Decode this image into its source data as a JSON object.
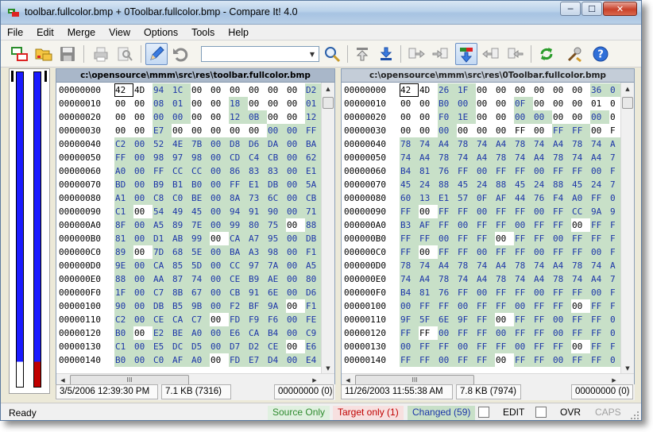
{
  "window": {
    "title": "toolbar.fullcolor.bmp + 0Toolbar.fullcolor.bmp - Compare It! 4.0",
    "min_glyph": "─",
    "max_glyph": "☐",
    "close_glyph": "✕"
  },
  "menu": [
    "File",
    "Edit",
    "Merge",
    "View",
    "Options",
    "Tools",
    "Help"
  ],
  "toolbar": {
    "search_value": "",
    "combo_arrow": "▼"
  },
  "colors": {
    "diff_bg": "#c8e0c8",
    "diff_text": "#1c36a8",
    "map_blue": "#1a1aff",
    "map_red": "#c00000",
    "source_only": "#2e8b2e",
    "target_only": "#c00000",
    "changed": "#1c36a8"
  },
  "left_pane": {
    "path": "c:\\opensource\\mmm\\src\\res\\toolbar.fullcolor.bmp",
    "date": "3/5/2006  12:39:30 PM",
    "size": "7.1 KB (7316)",
    "offset": "00000000 (0)",
    "scroll_glyph": "III",
    "rows": [
      {
        "addr": "00000000",
        "bytes": [
          "42",
          "4D",
          "94",
          "1C",
          "00",
          "00",
          "00",
          "00",
          "00",
          "00",
          "D2"
        ],
        "diff": [
          0,
          0,
          1,
          1,
          0,
          0,
          0,
          0,
          0,
          0,
          1
        ]
      },
      {
        "addr": "00000010",
        "bytes": [
          "00",
          "00",
          "08",
          "01",
          "00",
          "00",
          "18",
          "00",
          "00",
          "00",
          "01"
        ],
        "diff": [
          0,
          0,
          1,
          1,
          0,
          0,
          1,
          0,
          0,
          0,
          1
        ]
      },
      {
        "addr": "00000020",
        "bytes": [
          "00",
          "00",
          "00",
          "00",
          "00",
          "00",
          "12",
          "0B",
          "00",
          "00",
          "12"
        ],
        "diff": [
          0,
          0,
          1,
          1,
          0,
          0,
          1,
          1,
          0,
          0,
          1
        ]
      },
      {
        "addr": "00000030",
        "bytes": [
          "00",
          "00",
          "E7",
          "00",
          "00",
          "00",
          "00",
          "00",
          "00",
          "00",
          "FF"
        ],
        "diff": [
          0,
          0,
          1,
          0,
          0,
          0,
          0,
          0,
          1,
          1,
          1
        ]
      },
      {
        "addr": "00000040",
        "bytes": [
          "C2",
          "00",
          "52",
          "4E",
          "7B",
          "00",
          "D8",
          "D6",
          "DA",
          "00",
          "BA"
        ],
        "diff": [
          1,
          1,
          1,
          1,
          1,
          1,
          1,
          1,
          1,
          1,
          1
        ]
      },
      {
        "addr": "00000050",
        "bytes": [
          "FF",
          "00",
          "98",
          "97",
          "98",
          "00",
          "CD",
          "C4",
          "CB",
          "00",
          "62"
        ],
        "diff": [
          1,
          1,
          1,
          1,
          1,
          1,
          1,
          1,
          1,
          1,
          1
        ]
      },
      {
        "addr": "00000060",
        "bytes": [
          "A0",
          "00",
          "FF",
          "CC",
          "CC",
          "00",
          "86",
          "83",
          "83",
          "00",
          "E1"
        ],
        "diff": [
          1,
          1,
          1,
          1,
          1,
          1,
          1,
          1,
          1,
          1,
          1
        ]
      },
      {
        "addr": "00000070",
        "bytes": [
          "BD",
          "00",
          "B9",
          "B1",
          "B0",
          "00",
          "FF",
          "E1",
          "DB",
          "00",
          "5A"
        ],
        "diff": [
          1,
          1,
          1,
          1,
          1,
          1,
          1,
          1,
          1,
          1,
          1
        ]
      },
      {
        "addr": "00000080",
        "bytes": [
          "A1",
          "00",
          "C8",
          "C0",
          "BE",
          "00",
          "8A",
          "73",
          "6C",
          "00",
          "CB"
        ],
        "diff": [
          1,
          1,
          1,
          1,
          1,
          1,
          1,
          1,
          1,
          1,
          1
        ]
      },
      {
        "addr": "00000090",
        "bytes": [
          "C1",
          "00",
          "54",
          "49",
          "45",
          "00",
          "94",
          "91",
          "90",
          "00",
          "71"
        ],
        "diff": [
          1,
          0,
          1,
          1,
          1,
          1,
          1,
          1,
          1,
          1,
          1
        ]
      },
      {
        "addr": "000000A0",
        "bytes": [
          "8F",
          "00",
          "A5",
          "89",
          "7E",
          "00",
          "99",
          "80",
          "75",
          "00",
          "88"
        ],
        "diff": [
          1,
          1,
          1,
          1,
          1,
          1,
          1,
          1,
          1,
          0,
          1
        ]
      },
      {
        "addr": "000000B0",
        "bytes": [
          "81",
          "00",
          "D1",
          "AB",
          "99",
          "00",
          "CA",
          "A7",
          "95",
          "00",
          "DB"
        ],
        "diff": [
          1,
          1,
          1,
          1,
          1,
          0,
          1,
          1,
          1,
          1,
          1
        ]
      },
      {
        "addr": "000000C0",
        "bytes": [
          "89",
          "00",
          "7D",
          "68",
          "5E",
          "00",
          "BA",
          "A3",
          "98",
          "00",
          "F1"
        ],
        "diff": [
          1,
          0,
          1,
          1,
          1,
          1,
          1,
          1,
          1,
          1,
          1
        ]
      },
      {
        "addr": "000000D0",
        "bytes": [
          "9E",
          "00",
          "CA",
          "85",
          "5D",
          "00",
          "CC",
          "97",
          "7A",
          "00",
          "A5"
        ],
        "diff": [
          1,
          1,
          1,
          1,
          1,
          1,
          1,
          1,
          1,
          1,
          1
        ]
      },
      {
        "addr": "000000E0",
        "bytes": [
          "88",
          "00",
          "AA",
          "87",
          "74",
          "00",
          "CE",
          "B9",
          "AE",
          "00",
          "80"
        ],
        "diff": [
          1,
          1,
          1,
          1,
          1,
          1,
          1,
          1,
          1,
          1,
          1
        ]
      },
      {
        "addr": "000000F0",
        "bytes": [
          "1F",
          "00",
          "C7",
          "8B",
          "67",
          "00",
          "CB",
          "91",
          "6E",
          "00",
          "D6"
        ],
        "diff": [
          1,
          1,
          1,
          1,
          1,
          1,
          1,
          1,
          1,
          1,
          1
        ]
      },
      {
        "addr": "00000100",
        "bytes": [
          "90",
          "00",
          "DB",
          "B5",
          "9B",
          "00",
          "F2",
          "BF",
          "9A",
          "00",
          "F1"
        ],
        "diff": [
          1,
          1,
          1,
          1,
          1,
          1,
          1,
          1,
          1,
          0,
          1
        ]
      },
      {
        "addr": "00000110",
        "bytes": [
          "C2",
          "00",
          "CE",
          "CA",
          "C7",
          "00",
          "FD",
          "F9",
          "F6",
          "00",
          "FE"
        ],
        "diff": [
          1,
          1,
          1,
          1,
          1,
          0,
          1,
          1,
          1,
          1,
          1
        ]
      },
      {
        "addr": "00000120",
        "bytes": [
          "B0",
          "00",
          "E2",
          "BE",
          "A0",
          "00",
          "E6",
          "CA",
          "B4",
          "00",
          "C9"
        ],
        "diff": [
          1,
          0,
          1,
          1,
          1,
          1,
          1,
          1,
          1,
          1,
          1
        ]
      },
      {
        "addr": "00000130",
        "bytes": [
          "C1",
          "00",
          "E5",
          "DC",
          "D5",
          "00",
          "D7",
          "D2",
          "CE",
          "00",
          "E6"
        ],
        "diff": [
          1,
          1,
          1,
          1,
          1,
          1,
          1,
          1,
          1,
          0,
          1
        ]
      },
      {
        "addr": "00000140",
        "bytes": [
          "B0",
          "00",
          "C0",
          "AF",
          "A0",
          "00",
          "FD",
          "E7",
          "D4",
          "00",
          "E4"
        ],
        "diff": [
          1,
          1,
          1,
          1,
          1,
          0,
          1,
          1,
          1,
          1,
          1
        ]
      }
    ]
  },
  "right_pane": {
    "path": "c:\\opensource\\mmm\\src\\res\\0Toolbar.fullcolor.bmp",
    "date": "11/26/2003  11:55:38 AM",
    "size": "7.8 KB (7974)",
    "offset": "00000000 (0)",
    "scroll_glyph": "III",
    "rows": [
      {
        "addr": "00000000",
        "bytes": [
          "42",
          "4D",
          "26",
          "1F",
          "00",
          "00",
          "00",
          "00",
          "00",
          "00",
          "36",
          "0"
        ],
        "diff": [
          0,
          0,
          1,
          1,
          0,
          0,
          0,
          0,
          0,
          0,
          1,
          1
        ]
      },
      {
        "addr": "00000010",
        "bytes": [
          "00",
          "00",
          "B0",
          "00",
          "00",
          "00",
          "0F",
          "00",
          "00",
          "00",
          "01",
          "0"
        ],
        "diff": [
          0,
          0,
          1,
          1,
          0,
          0,
          1,
          0,
          0,
          0,
          0,
          0
        ]
      },
      {
        "addr": "00000020",
        "bytes": [
          "00",
          "00",
          "F0",
          "1E",
          "00",
          "00",
          "00",
          "00",
          "00",
          "00",
          "00",
          "0"
        ],
        "diff": [
          0,
          0,
          1,
          1,
          0,
          0,
          1,
          1,
          0,
          0,
          1,
          0
        ]
      },
      {
        "addr": "00000030",
        "bytes": [
          "00",
          "00",
          "00",
          "00",
          "00",
          "00",
          "FF",
          "00",
          "FF",
          "FF",
          "00",
          "F"
        ],
        "diff": [
          0,
          0,
          1,
          0,
          0,
          0,
          0,
          0,
          1,
          1,
          0,
          0
        ]
      },
      {
        "addr": "00000040",
        "bytes": [
          "78",
          "74",
          "A4",
          "78",
          "74",
          "A4",
          "78",
          "74",
          "A4",
          "78",
          "74",
          "A"
        ],
        "diff": [
          1,
          1,
          1,
          1,
          1,
          1,
          1,
          1,
          1,
          1,
          1,
          1
        ]
      },
      {
        "addr": "00000050",
        "bytes": [
          "74",
          "A4",
          "78",
          "74",
          "A4",
          "78",
          "74",
          "A4",
          "78",
          "74",
          "A4",
          "7"
        ],
        "diff": [
          1,
          1,
          1,
          1,
          1,
          1,
          1,
          1,
          1,
          1,
          1,
          1
        ]
      },
      {
        "addr": "00000060",
        "bytes": [
          "B4",
          "81",
          "76",
          "FF",
          "00",
          "FF",
          "FF",
          "00",
          "FF",
          "FF",
          "00",
          "F"
        ],
        "diff": [
          1,
          1,
          1,
          1,
          1,
          1,
          1,
          1,
          1,
          1,
          1,
          1
        ]
      },
      {
        "addr": "00000070",
        "bytes": [
          "45",
          "24",
          "88",
          "45",
          "24",
          "88",
          "45",
          "24",
          "88",
          "45",
          "24",
          "7"
        ],
        "diff": [
          1,
          1,
          1,
          1,
          1,
          1,
          1,
          1,
          1,
          1,
          1,
          1
        ]
      },
      {
        "addr": "00000080",
        "bytes": [
          "60",
          "13",
          "E1",
          "57",
          "0F",
          "AF",
          "44",
          "76",
          "F4",
          "A0",
          "FF",
          "0"
        ],
        "diff": [
          1,
          1,
          1,
          1,
          1,
          1,
          1,
          1,
          1,
          1,
          1,
          1
        ]
      },
      {
        "addr": "00000090",
        "bytes": [
          "FF",
          "00",
          "FF",
          "FF",
          "00",
          "FF",
          "FF",
          "00",
          "FF",
          "CC",
          "9A",
          "9"
        ],
        "diff": [
          1,
          0,
          1,
          1,
          1,
          1,
          1,
          1,
          1,
          1,
          1,
          1
        ]
      },
      {
        "addr": "000000A0",
        "bytes": [
          "B3",
          "AF",
          "FF",
          "00",
          "FF",
          "FF",
          "00",
          "FF",
          "FF",
          "00",
          "FF",
          "F"
        ],
        "diff": [
          1,
          1,
          1,
          1,
          1,
          1,
          1,
          1,
          1,
          0,
          1,
          1
        ]
      },
      {
        "addr": "000000B0",
        "bytes": [
          "FF",
          "FF",
          "00",
          "FF",
          "FF",
          "00",
          "FF",
          "FF",
          "00",
          "FF",
          "FF",
          "F"
        ],
        "diff": [
          1,
          1,
          1,
          1,
          1,
          0,
          1,
          1,
          1,
          1,
          1,
          1
        ]
      },
      {
        "addr": "000000C0",
        "bytes": [
          "FF",
          "00",
          "FF",
          "FF",
          "00",
          "FF",
          "FF",
          "00",
          "FF",
          "FF",
          "00",
          "F"
        ],
        "diff": [
          1,
          0,
          1,
          1,
          1,
          1,
          1,
          1,
          1,
          1,
          1,
          1
        ]
      },
      {
        "addr": "000000D0",
        "bytes": [
          "78",
          "74",
          "A4",
          "78",
          "74",
          "A4",
          "78",
          "74",
          "A4",
          "78",
          "74",
          "A"
        ],
        "diff": [
          1,
          1,
          1,
          1,
          1,
          1,
          1,
          1,
          1,
          1,
          1,
          1
        ]
      },
      {
        "addr": "000000E0",
        "bytes": [
          "74",
          "A4",
          "78",
          "74",
          "A4",
          "78",
          "74",
          "A4",
          "78",
          "74",
          "A4",
          "7"
        ],
        "diff": [
          1,
          1,
          1,
          1,
          1,
          1,
          1,
          1,
          1,
          1,
          1,
          1
        ]
      },
      {
        "addr": "000000F0",
        "bytes": [
          "B4",
          "81",
          "76",
          "FF",
          "00",
          "FF",
          "FF",
          "00",
          "FF",
          "FF",
          "00",
          "F"
        ],
        "diff": [
          1,
          1,
          1,
          1,
          1,
          1,
          1,
          1,
          1,
          1,
          1,
          1
        ]
      },
      {
        "addr": "00000100",
        "bytes": [
          "00",
          "FF",
          "FF",
          "00",
          "FF",
          "FF",
          "00",
          "FF",
          "FF",
          "00",
          "FF",
          "F"
        ],
        "diff": [
          1,
          1,
          1,
          1,
          1,
          1,
          1,
          1,
          1,
          0,
          1,
          1
        ]
      },
      {
        "addr": "00000110",
        "bytes": [
          "9F",
          "5F",
          "6E",
          "9F",
          "FF",
          "00",
          "FF",
          "FF",
          "00",
          "FF",
          "FF",
          "0"
        ],
        "diff": [
          1,
          1,
          1,
          1,
          1,
          0,
          1,
          1,
          1,
          1,
          1,
          1
        ]
      },
      {
        "addr": "00000120",
        "bytes": [
          "FF",
          "FF",
          "00",
          "FF",
          "FF",
          "00",
          "FF",
          "FF",
          "00",
          "FF",
          "FF",
          "0"
        ],
        "diff": [
          1,
          0,
          1,
          1,
          1,
          1,
          1,
          1,
          1,
          1,
          1,
          1
        ]
      },
      {
        "addr": "00000130",
        "bytes": [
          "00",
          "FF",
          "FF",
          "00",
          "FF",
          "FF",
          "00",
          "FF",
          "FF",
          "00",
          "FF",
          "F"
        ],
        "diff": [
          1,
          1,
          1,
          1,
          1,
          1,
          1,
          1,
          1,
          0,
          1,
          1
        ]
      },
      {
        "addr": "00000140",
        "bytes": [
          "FF",
          "FF",
          "00",
          "FF",
          "FF",
          "00",
          "FF",
          "FF",
          "00",
          "FF",
          "FF",
          "0"
        ],
        "diff": [
          1,
          1,
          1,
          1,
          1,
          0,
          1,
          1,
          1,
          1,
          1,
          1
        ]
      }
    ]
  },
  "status": {
    "ready": "Ready",
    "source_only": "Source Only",
    "target_only": "Target only (1)",
    "changed": "Changed (59)",
    "edit": "EDIT",
    "ovr": "OVR",
    "caps": "CAPS"
  }
}
